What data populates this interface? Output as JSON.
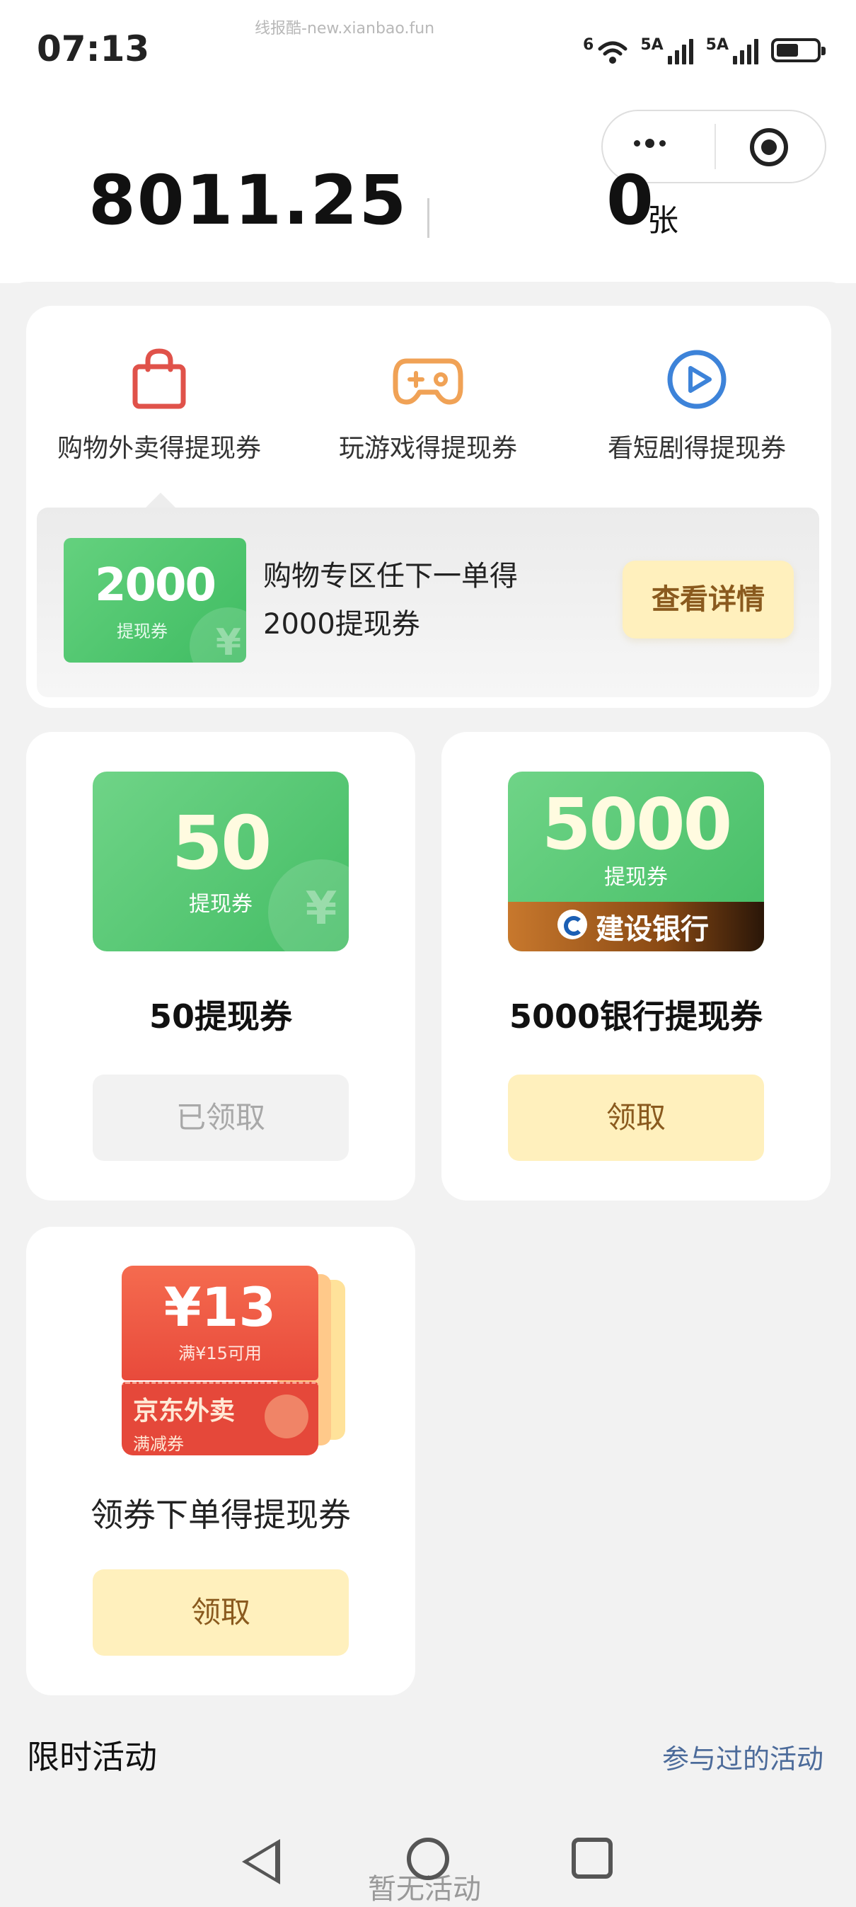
{
  "status_bar": {
    "time": "07:13",
    "watermark": "线报酷-new.xianbao.fun",
    "wifi_label": "6",
    "signal_1_label": "5A",
    "signal_2_label": "5A",
    "battery_level": 0.55
  },
  "capsule": {
    "more_icon": "more-dots-icon",
    "close_icon": "target-circle-icon"
  },
  "summary": {
    "balance": "8011.25",
    "voucher_count": "0",
    "voucher_unit": "张"
  },
  "tabs": [
    {
      "label": "购物外卖得提现券",
      "icon": "shopping-bag-icon",
      "color": "#e0524a"
    },
    {
      "label": "玩游戏得提现券",
      "icon": "gamepad-icon",
      "color": "#f0a256"
    },
    {
      "label": "看短剧得提现券",
      "icon": "play-circle-icon",
      "color": "#3d83d9"
    }
  ],
  "promo": {
    "ticket_value": "2000",
    "ticket_sub": "提现券",
    "ticket_watermark": "¥",
    "text": "购物专区任下一单得2000提现券",
    "button": "查看详情"
  },
  "cards": {
    "card_50": {
      "ticket_value": "50",
      "ticket_sub": "提现券",
      "ticket_watermark": "¥",
      "title": "50提现券",
      "button": "已领取"
    },
    "card_5000": {
      "ticket_value": "5000",
      "ticket_sub": "提现券",
      "bank_name": "建设银行",
      "title": "5000银行提现券",
      "button": "领取"
    },
    "card_jd": {
      "coupon_value": "¥13",
      "coupon_condition": "满¥15可用",
      "coupon_brand": "京东外卖",
      "coupon_type": "满减券",
      "title": "领券下单得提现券",
      "button": "领取"
    }
  },
  "limited": {
    "title": "限时活动",
    "link": "参与过的活动",
    "empty": "暂无活动"
  },
  "colors": {
    "accent_green": "#4cc26c",
    "button_yellow": "#fff0bd",
    "button_text_brown": "#8a5a1e",
    "link_blue": "#4c6b9a"
  }
}
